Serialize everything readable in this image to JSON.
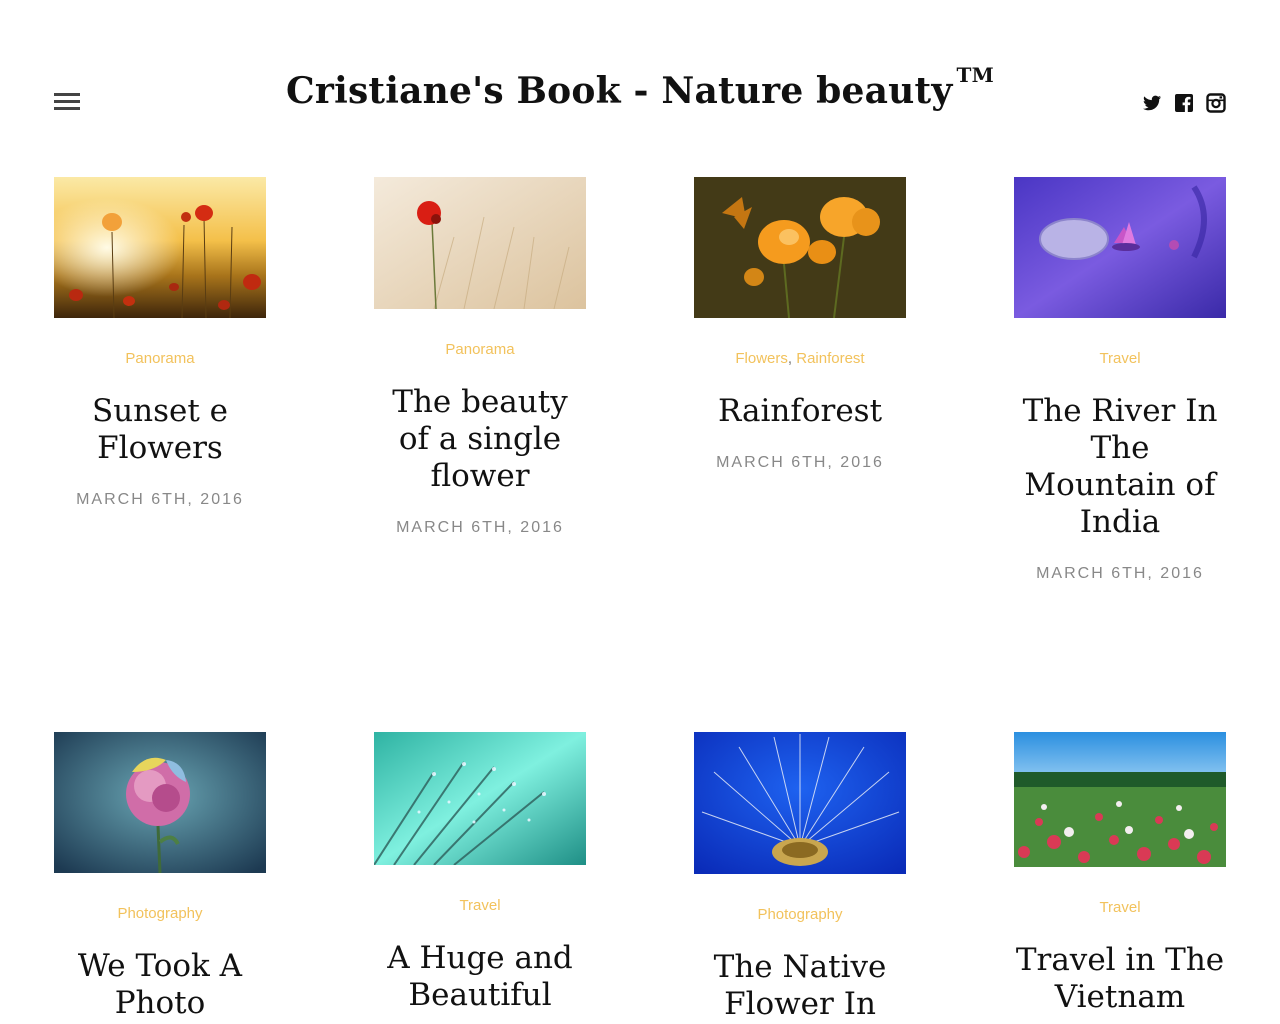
{
  "header": {
    "title": "Cristiane's Book - Nature beauty",
    "trademark": "TM",
    "menu_icon": "hamburger-icon",
    "social": [
      {
        "name": "twitter-icon"
      },
      {
        "name": "facebook-icon"
      },
      {
        "name": "instagram-icon"
      }
    ]
  },
  "posts": [
    {
      "image": "sunset-poppies-image",
      "categories": [
        "Panorama"
      ],
      "title": "Sunset e Flowers",
      "date": "March 6th, 2016"
    },
    {
      "image": "single-poppy-image",
      "categories": [
        "Panorama"
      ],
      "title": "The beauty of a single flower",
      "date": "March 6th, 2016"
    },
    {
      "image": "butterfly-flowers-image",
      "categories": [
        "Flowers",
        "Rainforest"
      ],
      "title": "Rainforest",
      "date": "March 6th, 2016"
    },
    {
      "image": "lotus-pond-image",
      "categories": [
        "Travel"
      ],
      "title": "The River In The Mountain of India",
      "date": "March 6th, 2016"
    },
    {
      "image": "rose-image",
      "categories": [
        "Photography"
      ],
      "title": "We Took A Photo"
    },
    {
      "image": "dew-dandelion-image",
      "categories": [
        "Travel"
      ],
      "title": "A Huge and Beautiful"
    },
    {
      "image": "dandelion-blue-image",
      "categories": [
        "Photography"
      ],
      "title": "The Native Flower In"
    },
    {
      "image": "flower-field-image",
      "categories": [
        "Travel"
      ],
      "title": "Travel in The Vietnam"
    }
  ],
  "colors": {
    "category": "#f2c25c",
    "date": "#888888",
    "title": "#111111"
  }
}
